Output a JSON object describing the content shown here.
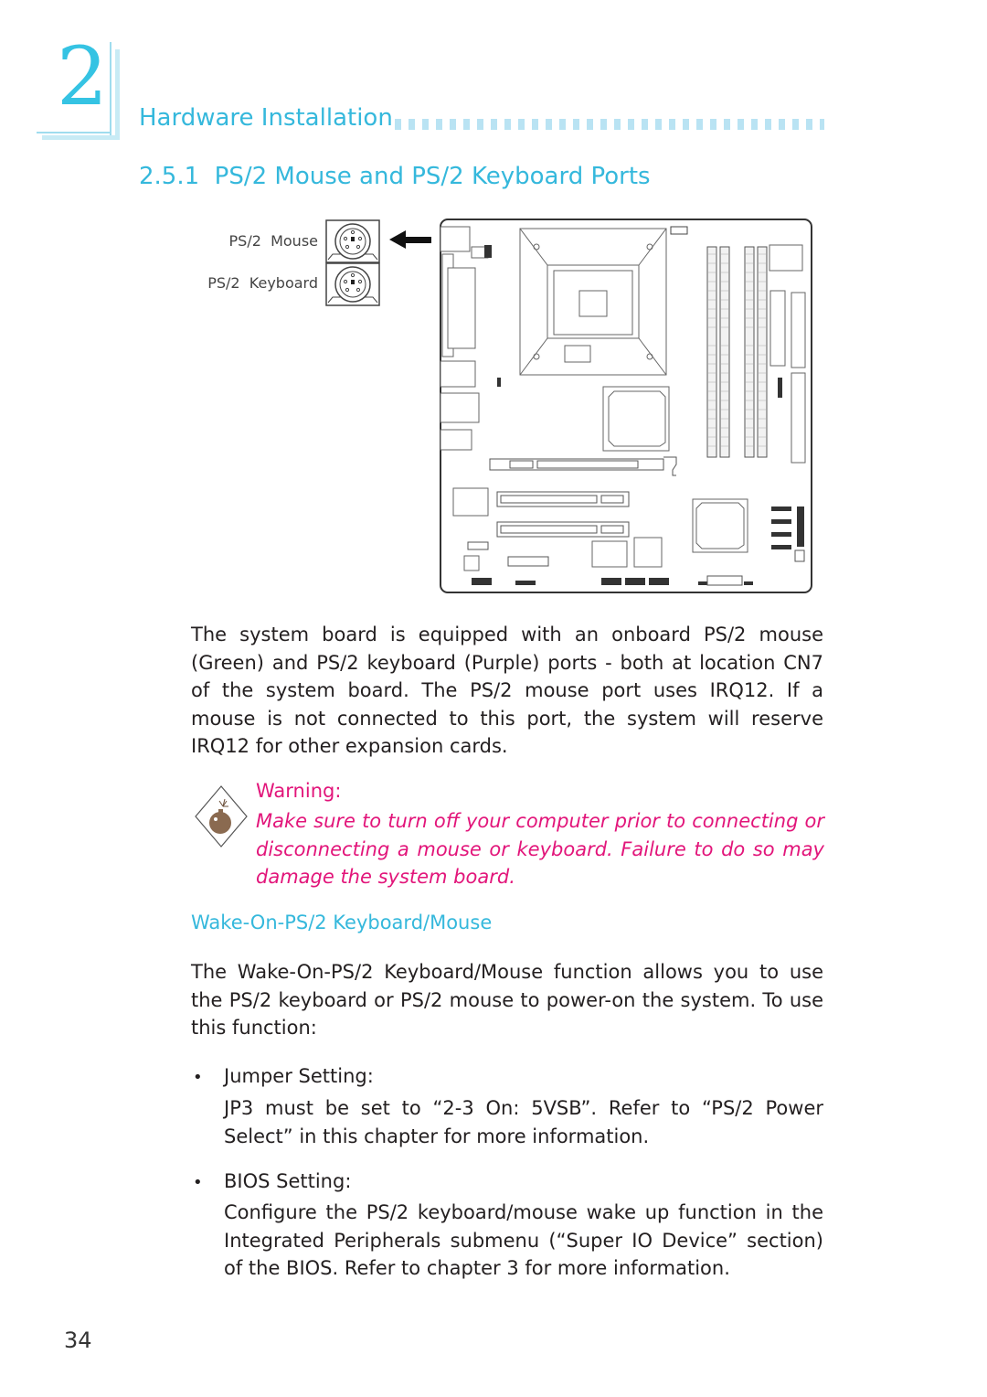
{
  "chapter": {
    "number": "2",
    "title": "Hardware Installation"
  },
  "section": {
    "title": "2.5.1  PS/2 Mouse and PS/2 Keyboard Ports"
  },
  "diagram": {
    "mouse_label": "PS/2  Mouse",
    "keyboard_label": "PS/2  Keyboard"
  },
  "intro_paragraph": "The system board is equipped with an onboard PS/2 mouse (Green) and PS/2 keyboard (Purple) ports - both at location CN7 of the system board. The PS/2 mouse port uses IRQ12. If a mouse is not connected to this port, the system will reserve IRQ12 for other expansion cards.",
  "warning": {
    "icon": "bomb-icon",
    "title": "Warning:",
    "text": "Make sure to turn off your computer prior to connecting or disconnecting a mouse or keyboard. Failure to do so may damage the system board.",
    "color": "#e2157a"
  },
  "wake": {
    "heading": "Wake-On-PS/2 Keyboard/Mouse",
    "paragraph": "The Wake-On-PS/2 Keyboard/Mouse function allows you to use the PS/2 keyboard or PS/2 mouse to power-on the system. To use this function:",
    "items": [
      {
        "bullet": "•",
        "title": "Jumper Setting:",
        "text": "JP3 must be set to “2-3 On: 5VSB”. Refer to “PS/2 Power Select” in this chapter for more information."
      },
      {
        "bullet": "•",
        "title": "BIOS Setting:",
        "text": "Configure the PS/2 keyboard/mouse wake up function in the Integrated Peripherals submenu (“Super IO Device” section) of the BIOS. Refer to chapter 3 for more information."
      }
    ]
  },
  "page_number": "34",
  "colors": {
    "accent": "#35b8dc",
    "accent_light": "#b9e3f3",
    "warning": "#e2157a",
    "text": "#231f20"
  }
}
